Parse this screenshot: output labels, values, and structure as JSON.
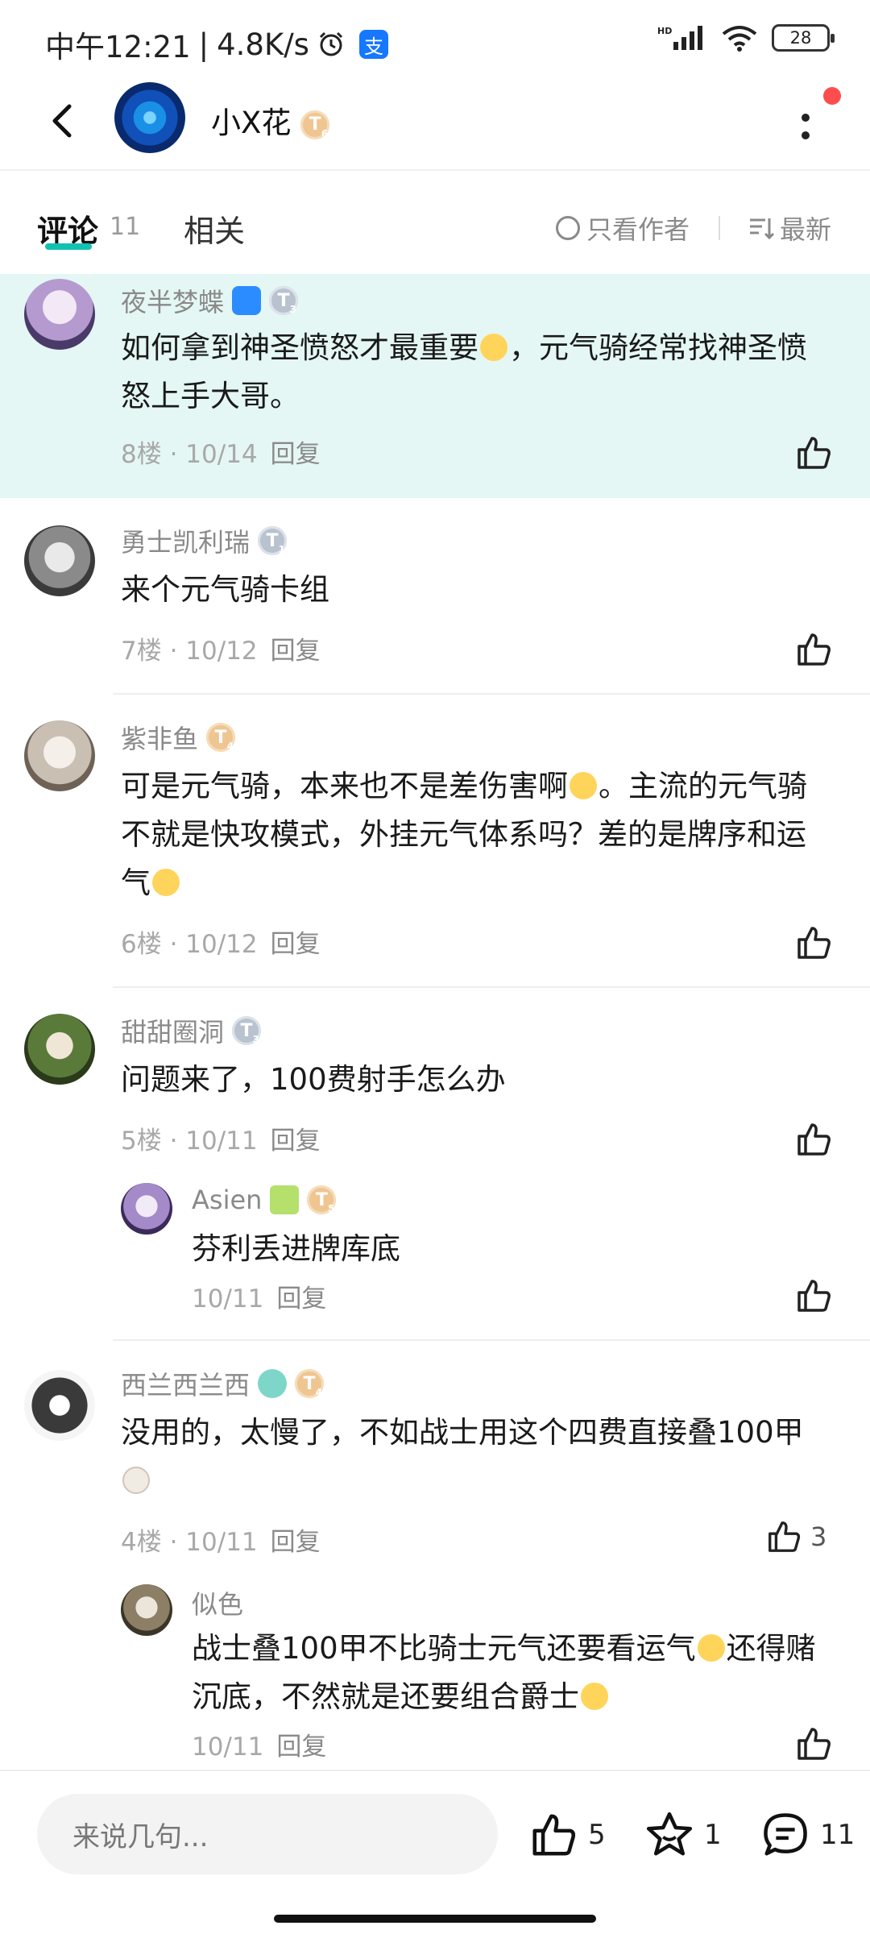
{
  "status_bar": {
    "time": "中午12:21",
    "speed": "4.8K/s",
    "app_icon": "支",
    "signal": "HD",
    "battery": "28"
  },
  "header": {
    "name": "小X花",
    "level": "T",
    "level_sub": "6"
  },
  "tabs": {
    "comment_label": "评论",
    "comment_count": "11",
    "related_label": "相关",
    "author_only_label": "只看作者",
    "sort_label": "最新"
  },
  "comments": [
    {
      "user": "夜半梦蝶",
      "level": "T",
      "level_sub": "3",
      "text_a": "如何拿到神圣愤怒才最重要",
      "text_b": "，元气骑经常找神圣愤怒上手大哥。",
      "floor": "8楼",
      "date": "10/14",
      "reply": "回复"
    },
    {
      "user": "勇士凯利瑞",
      "level": "T",
      "level_sub": "1",
      "text": "来个元气骑卡组",
      "floor": "7楼",
      "date": "10/12",
      "reply": "回复"
    },
    {
      "user": "紫非鱼",
      "level": "T",
      "level_sub": "4",
      "text_a": "可是元气骑，本来也不是差伤害啊",
      "text_b": "。主流的元气骑不就是快攻模式，外挂元气体系吗？差的是牌序和运气",
      "floor": "6楼",
      "date": "10/12",
      "reply": "回复"
    },
    {
      "user": "甜甜圈洞",
      "level": "T",
      "level_sub": "3",
      "text": "问题来了，100费射手怎么办",
      "floor": "5楼",
      "date": "10/11",
      "reply": "回复",
      "sub_reply": {
        "user": "Asien",
        "level": "T",
        "level_sub": "5",
        "text": "芬利丢进牌库底",
        "date": "10/11",
        "reply": "回复"
      }
    },
    {
      "user": "西兰西兰西",
      "level": "T",
      "level_sub": "4",
      "text": "没用的，太慢了，不如战士用这个四费直接叠100甲",
      "floor": "4楼",
      "date": "10/11",
      "reply": "回复",
      "likes": "3",
      "sub_reply": {
        "user": "似色",
        "text_a": "战士叠100甲不比骑士元气还要看运气",
        "text_b": "还得赌沉底，不然就是还要组合爵士",
        "date": "10/11",
        "reply": "回复"
      }
    }
  ],
  "meta_separator": " · ",
  "bottom_bar": {
    "input_placeholder": "来说几句...",
    "like_count": "5",
    "favorite_count": "1",
    "comment_count": "11"
  },
  "colors": {
    "accent": "#12c2b0",
    "highlight_bg": "#e4f7f4",
    "notification_dot": "#ff4d4f"
  }
}
